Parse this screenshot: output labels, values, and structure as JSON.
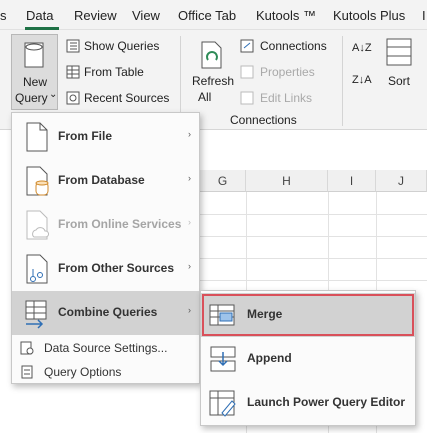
{
  "menubar": {
    "tabs": [
      "s",
      "Data",
      "Review",
      "View",
      "Office Tab",
      "Kutools ™",
      "Kutools Plus",
      "I"
    ],
    "active": "Data"
  },
  "ribbon": {
    "new_query": {
      "line1": "New",
      "line2": "Query",
      "caret": "⌄"
    },
    "show_queries": "Show Queries",
    "from_table": "From Table",
    "recent_sources": "Recent Sources",
    "refresh_all": {
      "line1": "Refresh",
      "line2": "All"
    },
    "connections": "Connections",
    "properties": "Properties",
    "edit_links": "Edit Links",
    "group_connections": "Connections",
    "sort_az": "A↓Z",
    "sort_za": "Z↓A",
    "sort": "Sort"
  },
  "sheet": {
    "columns": [
      "G",
      "H",
      "I",
      "J"
    ]
  },
  "new_query_menu": {
    "items": [
      {
        "label": "From File",
        "arrow": "›",
        "enabled": true,
        "icon": "file-icon"
      },
      {
        "label": "From Database",
        "arrow": "›",
        "enabled": true,
        "icon": "database-icon"
      },
      {
        "label": "From Online Services",
        "arrow": "›",
        "enabled": false,
        "icon": "cloud-icon"
      },
      {
        "label": "From Other Sources",
        "arrow": "›",
        "enabled": true,
        "icon": "other-sources-icon"
      },
      {
        "label": "Combine Queries",
        "arrow": "›",
        "enabled": true,
        "icon": "combine-icon",
        "highlighted": true
      }
    ],
    "small_items": [
      {
        "label": "Data Source Settings...",
        "icon": "settings-icon"
      },
      {
        "label": "Query Options",
        "icon": "options-icon"
      }
    ]
  },
  "combine_submenu": {
    "items": [
      {
        "label": "Merge",
        "icon": "merge-icon",
        "highlighted": true
      },
      {
        "label": "Append",
        "icon": "append-icon"
      },
      {
        "label": "Launch Power Query Editor",
        "icon": "editor-icon"
      }
    ]
  },
  "colors": {
    "accent": "#1e7145",
    "highlight": "#d2d2d2",
    "merge_border": "#d9505a",
    "icon_blue": "#2f6fb5"
  }
}
